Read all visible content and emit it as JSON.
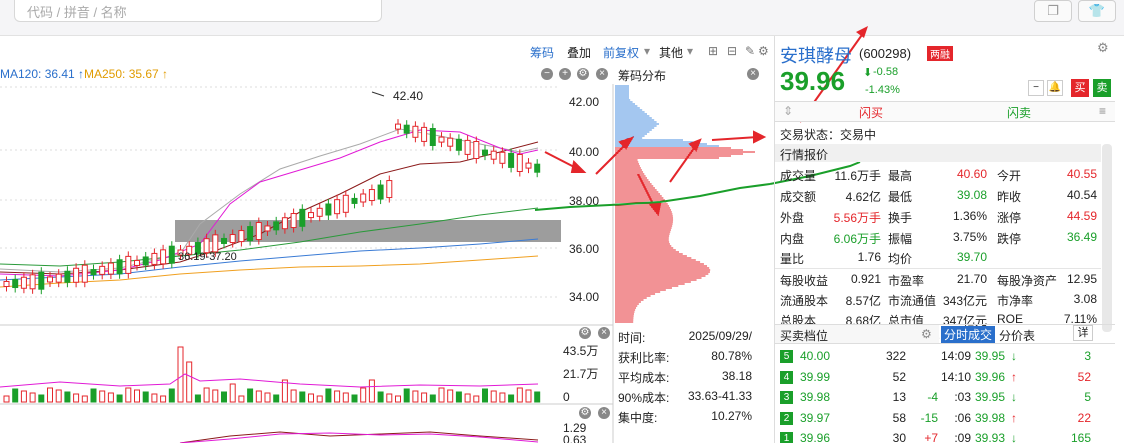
{
  "search": {
    "placeholder": "代码 / 拼音 / 名称"
  },
  "toolbar": {
    "chips": "筹码",
    "overlay": "叠加",
    "adjust": "前复权",
    "other": "其他"
  },
  "ma": {
    "ma120": "MA120: 36.41 ↑",
    "ma250": "MA250: 35.67 ↑"
  },
  "chart": {
    "high_marker": "42.40",
    "range_label": "36.19-37.20",
    "price_ticks": [
      "42.00",
      "40.00",
      "38.00",
      "36.00",
      "34.00"
    ],
    "vol_ticks": [
      "43.5万",
      "21.7万",
      "0"
    ],
    "macd_ticks": [
      "1.29",
      "0.63"
    ]
  },
  "chip_panel": {
    "title": "筹码分布",
    "stats": [
      {
        "label": "时间:",
        "value": "2025/09/29/"
      },
      {
        "label": "获利比率:",
        "value": "80.78%"
      },
      {
        "label": "平均成本:",
        "value": "38.18"
      },
      {
        "label": "90%成本:",
        "value": "33.63-41.33"
      },
      {
        "label": "集中度:",
        "value": "10.27%"
      }
    ]
  },
  "stock": {
    "name": "安琪酵母",
    "code": "(600298)",
    "tag": "两融",
    "price": "39.96",
    "change": "-0.58",
    "change_pct": "-1.43%",
    "buy_btn": "买",
    "sell_btn": "卖",
    "flash_buy": "闪买",
    "flash_sell": "闪卖",
    "trade_status": "交易状态：交易中",
    "section_title": "行情报价"
  },
  "quote": [
    {
      "l1": "成交量",
      "v1": "11.6万手",
      "l2": "最高",
      "v2": "40.60",
      "l3": "今开",
      "v3": "40.55"
    },
    {
      "l1": "成交额",
      "v1": "4.62亿",
      "l2": "最低",
      "v2": "39.08",
      "l3": "昨收",
      "v3": "40.54"
    },
    {
      "l1": "外盘",
      "v1": "5.56万手",
      "l2": "换手",
      "v2": "1.36%",
      "l3": "涨停",
      "v3": "44.59"
    },
    {
      "l1": "内盘",
      "v1": "6.06万手",
      "l2": "振幅",
      "v2": "3.75%",
      "l3": "跌停",
      "v3": "36.49"
    },
    {
      "l1": "量比",
      "v1": "1.76",
      "l2": "均价",
      "v2": "39.70",
      "l3": "",
      "v3": ""
    }
  ],
  "fundamentals": [
    {
      "l1": "每股收益",
      "v1": "0.921",
      "l2": "市盈率",
      "v2": "21.70",
      "l3": "每股净资产",
      "v3": "12.95"
    },
    {
      "l1": "流通股本",
      "v1": "8.57亿",
      "l2": "市流通值",
      "v2": "343亿元",
      "l3": "市净率",
      "v3": "3.08"
    },
    {
      "l1": "总股本",
      "v1": "8.68亿",
      "l2": "总市值",
      "v2": "347亿元",
      "l3": "ROE",
      "v3": "7.11%"
    }
  ],
  "orderbook": {
    "title": "买卖档位",
    "rows": [
      {
        "lvl": "5",
        "price": "40.00",
        "vol": "322",
        "chg": ""
      },
      {
        "lvl": "4",
        "price": "39.99",
        "vol": "52",
        "chg": ""
      },
      {
        "lvl": "3",
        "price": "39.98",
        "vol": "13",
        "chg": "-4"
      },
      {
        "lvl": "2",
        "price": "39.97",
        "vol": "58",
        "chg": "-15"
      },
      {
        "lvl": "1",
        "price": "39.96",
        "vol": "30",
        "chg": "+7"
      }
    ]
  },
  "ticks": {
    "tab_active": "分时成交",
    "tab2": "分价表",
    "detail": "详",
    "rows": [
      {
        "time": "14:09",
        "price": "39.95",
        "dir": "↓",
        "vol": "3"
      },
      {
        "time": "14:10",
        "price": "39.96",
        "dir": "↑",
        "vol": "52"
      },
      {
        "time": ":03",
        "price": "39.95",
        "dir": "↓",
        "vol": "5"
      },
      {
        "time": ":06",
        "price": "39.98",
        "dir": "↑",
        "vol": "22"
      },
      {
        "time": ":09",
        "price": "39.93",
        "dir": "↓",
        "vol": "165"
      }
    ]
  },
  "colors": {
    "up": "#e4262b",
    "down": "#1a9f2a",
    "accent": "#2a6fcb"
  }
}
